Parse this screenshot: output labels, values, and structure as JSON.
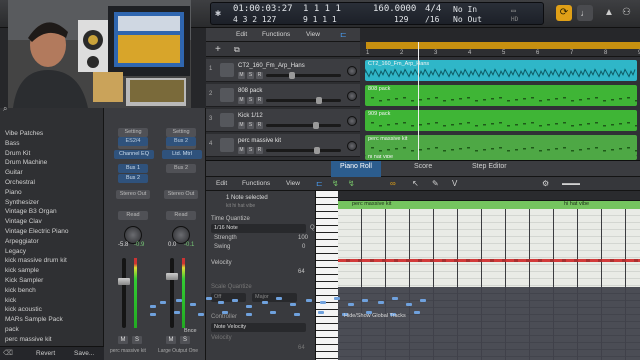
{
  "control_bar": {
    "time_position": "01:00:03:27",
    "time_sub": "4  3  2  127",
    "bars_position": "1  1  1    1",
    "bars_end": "9  1  1    1",
    "tempo": "160.0000",
    "keep_tempo": "129",
    "signature": "4/4",
    "division": "/16",
    "midi_in": "No In",
    "midi_out": "No Out"
  },
  "webcam": {
    "caption": "instructor webcam overlay"
  },
  "library": {
    "items": [
      "Vibe Patches",
      "Bass",
      "Drum Kit",
      "Drum Machine",
      "Guitar",
      "Orchestral",
      "Piano",
      "Synthesizer",
      "Vintage B3 Organ",
      "Vintage Clav",
      "Vintage Electric Piano",
      "Arpeggiator",
      "Legacy",
      "kick massive drum kit",
      "kick sample",
      "Kick Sampler",
      "kick bench",
      "kick",
      "kick acoustic",
      "MARs Sample Pack",
      "pack",
      "perc massive kit"
    ],
    "revert_label": "Revert",
    "save_label": "Save..."
  },
  "inspector": {
    "setting_label": "Setting",
    "eq_label": "EQ",
    "compress_label": "Compr",
    "channel_eq": "Channel EQ",
    "eq_right": "Ltd. Mtrl",
    "bus1": "Bus 1",
    "bus2": "Bus 2",
    "bus_right": "Bus 2",
    "stereo_out_left": "Stereo Out",
    "stereo_out_right": "Stereo Out",
    "group_left": "Read",
    "group_right": "Read",
    "vol_left": "-5.8",
    "peak_left": "-0.9",
    "vol_right": "0.0",
    "peak_right": "-0.1",
    "bounce_label": "Bnce",
    "channel_name_left": "perc massive kit",
    "channel_name_right": "Large Output One"
  },
  "tracks_toolbar": {
    "edit": "Edit",
    "functions": "Functions",
    "view": "View"
  },
  "tracks": [
    {
      "num": "1",
      "name": "CT2_160_Fm_Arp_Hans",
      "volume_pct": 0.34,
      "color": "#2fb6c8"
    },
    {
      "num": "2",
      "name": "808 pack",
      "volume_pct": 0.72,
      "color": "#44b53a"
    },
    {
      "num": "3",
      "name": "Kick 1/12",
      "volume_pct": 0.68,
      "color": "#44b53a"
    },
    {
      "num": "4",
      "name": "perc massive kit",
      "volume_pct": 0.7,
      "color": "#44b53a"
    }
  ],
  "regions": [
    "CT2_160_Fm_Arp_Hans",
    "808 pack",
    "909 pack",
    "perc massive kit",
    "hi hat vibe"
  ],
  "ruler_marks": [
    "1",
    "2",
    "3",
    "4",
    "5",
    "6",
    "7",
    "8",
    "9"
  ],
  "editor": {
    "tabs": [
      "Piano Roll",
      "Score",
      "Step Editor"
    ],
    "active_tab": "Piano Roll",
    "toolbar": {
      "edit": "Edit",
      "functions": "Functions",
      "view": "View"
    },
    "selection_info": "1 Note selected",
    "selection_sub": "kit hi hat vibe",
    "time_quantize_label": "Time Quantize",
    "quantize_value": "1/16 Note",
    "strength_label": "Strength",
    "strength_value": "100",
    "swing_label": "Swing",
    "swing_value": "0",
    "velocity_label": "Velocity",
    "velocity_value": "64",
    "scale_quantize_label": "Scale Quantize",
    "scale_off": "Off",
    "scale_major": "Major",
    "controller_label": "Controller",
    "controller_value": "Note Velocity",
    "controller_value_num": "64",
    "region_left": "perc massive kit",
    "region_right": "hi hat vibe",
    "hint": "Hide/Show Global Tracks"
  }
}
